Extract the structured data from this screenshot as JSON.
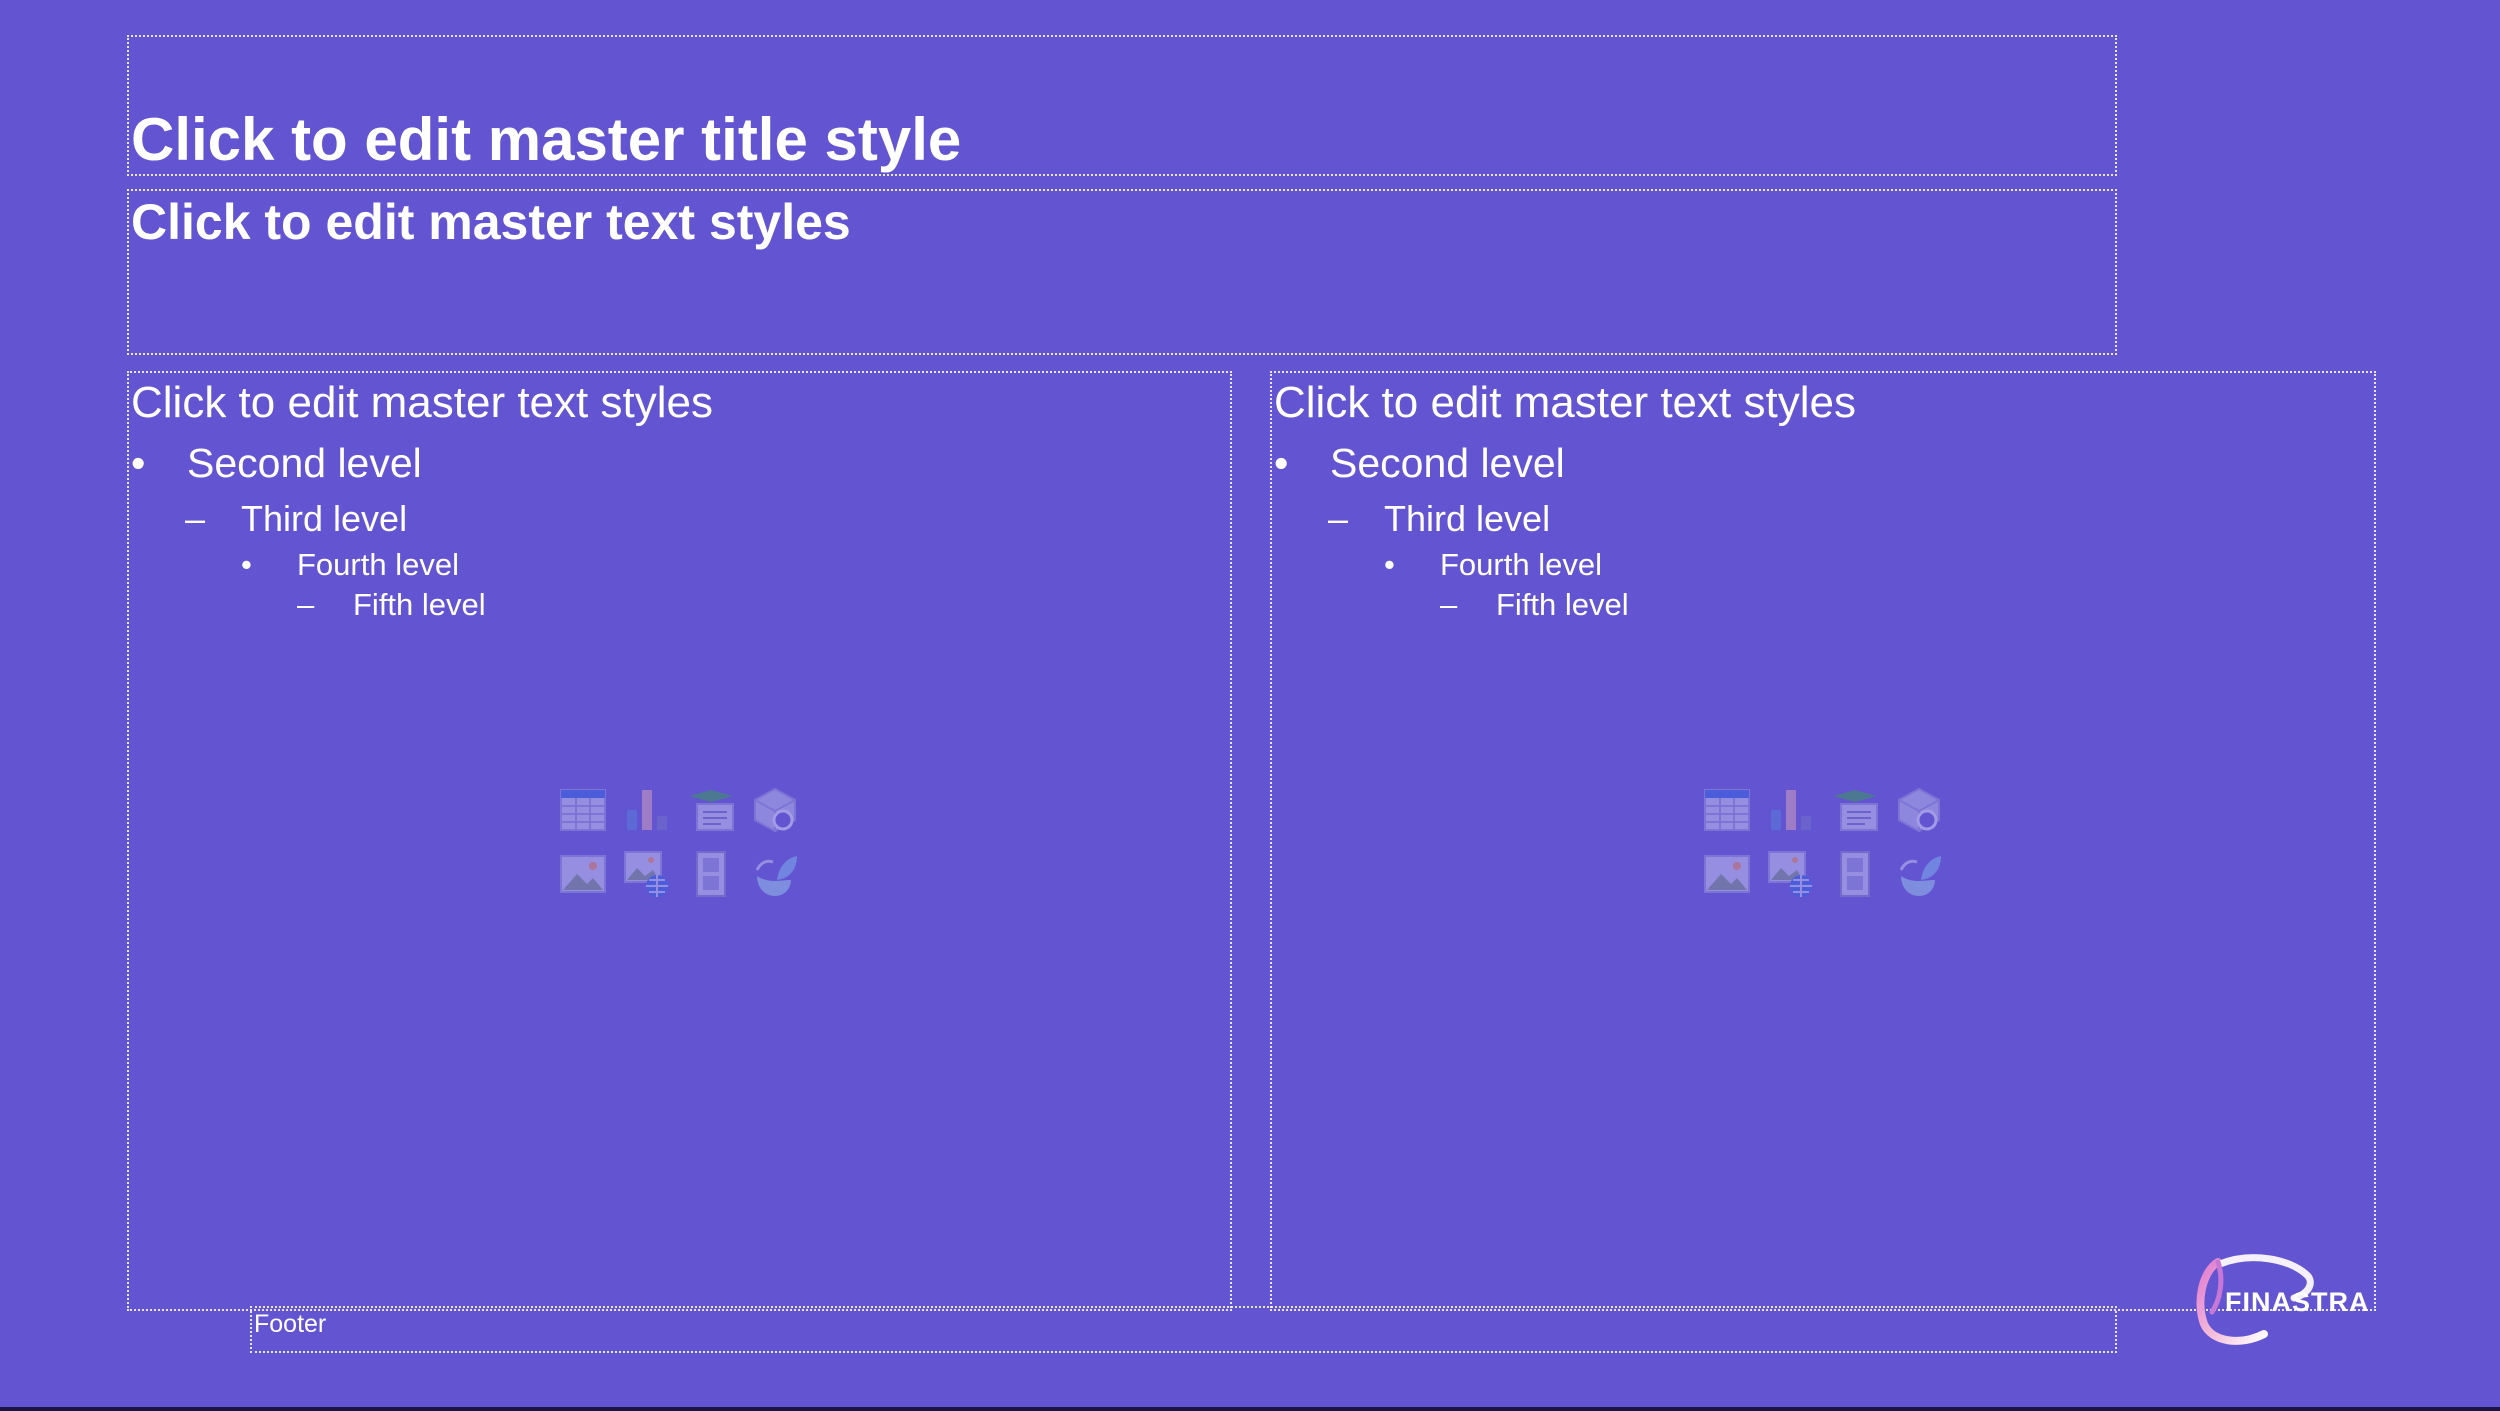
{
  "slide": {
    "background_color": "#6355d1",
    "title": "Click to edit master title style",
    "subtitle": "Click to edit master text styles",
    "footer": "Footer",
    "logo_text": "FINASTRA"
  },
  "content_left": {
    "level1": "Click to edit master text styles",
    "level2": "Second level",
    "level3": "Third level",
    "level4": "Fourth level",
    "level5": "Fifth level",
    "bullet_round": "•",
    "bullet_dash": "–"
  },
  "content_right": {
    "level1": "Click to edit master text styles",
    "level2": "Second level",
    "level3": "Third level",
    "level4": "Fourth level",
    "level5": "Fifth level",
    "bullet_round": "•",
    "bullet_dash": "–"
  },
  "insert_icons": [
    "table-icon",
    "chart-icon",
    "smartart-icon",
    "3d-model-icon",
    "picture-icon",
    "online-picture-icon",
    "video-icon",
    "icons-icon"
  ]
}
